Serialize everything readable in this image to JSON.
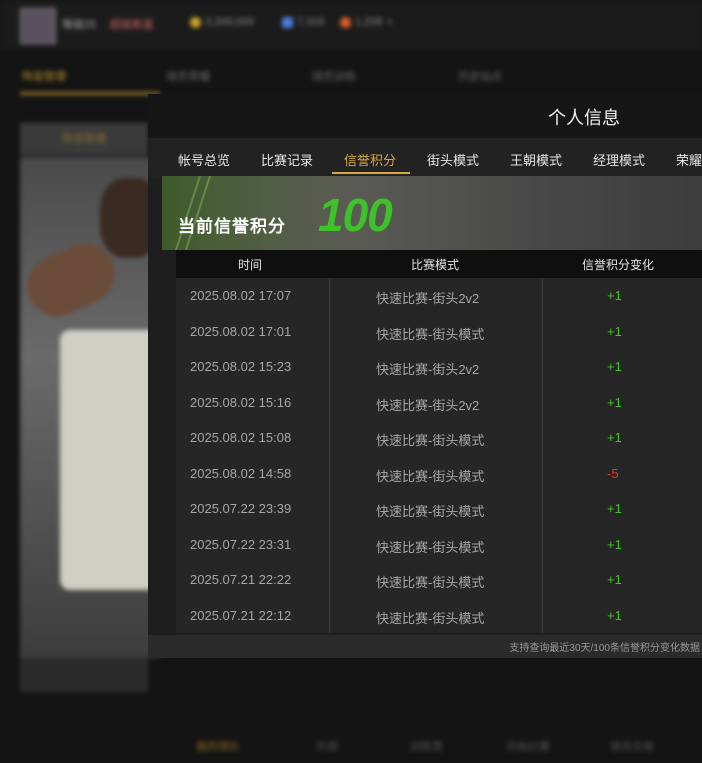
{
  "background": {
    "player_name": "等级25",
    "rank_label": "超级新星",
    "currencies": [
      {
        "icon": "gold-coin-icon",
        "value": "3,349,009",
        "color": "#c9a227"
      },
      {
        "icon": "diamond-icon",
        "value": "7,316",
        "color": "#4a7ed8"
      },
      {
        "icon": "ticket-icon",
        "value": "1,208",
        "color": "#d9602a"
      }
    ],
    "nav_tabs": [
      "阵容管理",
      "球员荣耀",
      "球员训练",
      "历史站点"
    ],
    "sub_tab": "阵容管理",
    "bottom_nav": [
      "我的球队",
      "外观",
      "训练营",
      "开始比赛",
      "球员交易"
    ]
  },
  "modal": {
    "title": "个人信息",
    "tabs": [
      "帐号总览",
      "比赛记录",
      "信誉积分",
      "街头模式",
      "王朝模式",
      "经理模式",
      "荣耀"
    ],
    "active_tab": 2,
    "banner_label": "当前信誉积分",
    "score": "100",
    "table": {
      "headers": [
        "时间",
        "比赛模式",
        "信誉积分变化"
      ],
      "rows": [
        {
          "time": "2025.08.02  17:07",
          "mode": "快速比赛-街头2v2",
          "change": "+1"
        },
        {
          "time": "2025.08.02  17:01",
          "mode": "快速比赛-街头模式",
          "change": "+1"
        },
        {
          "time": "2025.08.02  15:23",
          "mode": "快速比赛-街头2v2",
          "change": "+1"
        },
        {
          "time": "2025.08.02  15:16",
          "mode": "快速比赛-街头2v2",
          "change": "+1"
        },
        {
          "time": "2025.08.02  15:08",
          "mode": "快速比赛-街头模式",
          "change": "+1"
        },
        {
          "time": "2025.08.02  14:58",
          "mode": "快速比赛-街头模式",
          "change": "-5"
        },
        {
          "time": "2025.07.22  23:39",
          "mode": "快速比赛-街头模式",
          "change": "+1"
        },
        {
          "time": "2025.07.22  23:31",
          "mode": "快速比赛-街头模式",
          "change": "+1"
        },
        {
          "time": "2025.07.21  22:22",
          "mode": "快速比赛-街头模式",
          "change": "+1"
        },
        {
          "time": "2025.07.21  22:12",
          "mode": "快速比赛-街头模式",
          "change": "+1"
        }
      ]
    },
    "footnote": "支持查询最近30天/100条信誉积分变化数据"
  },
  "colors": {
    "accent_gold": "#d4a93d",
    "score_green": "#3dc22a",
    "positive": "#44c22a",
    "negative": "#d83a2e"
  }
}
